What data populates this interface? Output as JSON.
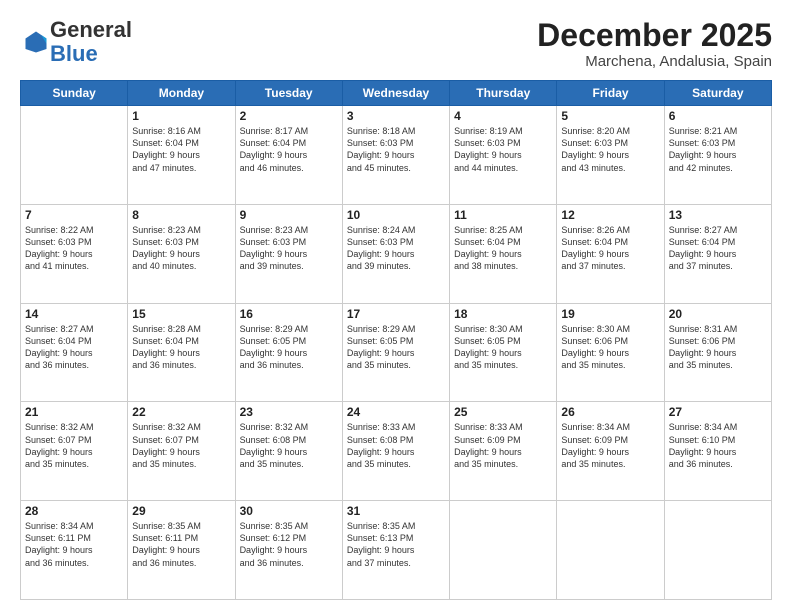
{
  "logo": {
    "general": "General",
    "blue": "Blue"
  },
  "header": {
    "month_year": "December 2025",
    "location": "Marchena, Andalusia, Spain"
  },
  "weekdays": [
    "Sunday",
    "Monday",
    "Tuesday",
    "Wednesday",
    "Thursday",
    "Friday",
    "Saturday"
  ],
  "weeks": [
    [
      {
        "day": "",
        "info": ""
      },
      {
        "day": "1",
        "info": "Sunrise: 8:16 AM\nSunset: 6:04 PM\nDaylight: 9 hours\nand 47 minutes."
      },
      {
        "day": "2",
        "info": "Sunrise: 8:17 AM\nSunset: 6:04 PM\nDaylight: 9 hours\nand 46 minutes."
      },
      {
        "day": "3",
        "info": "Sunrise: 8:18 AM\nSunset: 6:03 PM\nDaylight: 9 hours\nand 45 minutes."
      },
      {
        "day": "4",
        "info": "Sunrise: 8:19 AM\nSunset: 6:03 PM\nDaylight: 9 hours\nand 44 minutes."
      },
      {
        "day": "5",
        "info": "Sunrise: 8:20 AM\nSunset: 6:03 PM\nDaylight: 9 hours\nand 43 minutes."
      },
      {
        "day": "6",
        "info": "Sunrise: 8:21 AM\nSunset: 6:03 PM\nDaylight: 9 hours\nand 42 minutes."
      }
    ],
    [
      {
        "day": "7",
        "info": "Sunrise: 8:22 AM\nSunset: 6:03 PM\nDaylight: 9 hours\nand 41 minutes."
      },
      {
        "day": "8",
        "info": "Sunrise: 8:23 AM\nSunset: 6:03 PM\nDaylight: 9 hours\nand 40 minutes."
      },
      {
        "day": "9",
        "info": "Sunrise: 8:23 AM\nSunset: 6:03 PM\nDaylight: 9 hours\nand 39 minutes."
      },
      {
        "day": "10",
        "info": "Sunrise: 8:24 AM\nSunset: 6:03 PM\nDaylight: 9 hours\nand 39 minutes."
      },
      {
        "day": "11",
        "info": "Sunrise: 8:25 AM\nSunset: 6:04 PM\nDaylight: 9 hours\nand 38 minutes."
      },
      {
        "day": "12",
        "info": "Sunrise: 8:26 AM\nSunset: 6:04 PM\nDaylight: 9 hours\nand 37 minutes."
      },
      {
        "day": "13",
        "info": "Sunrise: 8:27 AM\nSunset: 6:04 PM\nDaylight: 9 hours\nand 37 minutes."
      }
    ],
    [
      {
        "day": "14",
        "info": "Sunrise: 8:27 AM\nSunset: 6:04 PM\nDaylight: 9 hours\nand 36 minutes."
      },
      {
        "day": "15",
        "info": "Sunrise: 8:28 AM\nSunset: 6:04 PM\nDaylight: 9 hours\nand 36 minutes."
      },
      {
        "day": "16",
        "info": "Sunrise: 8:29 AM\nSunset: 6:05 PM\nDaylight: 9 hours\nand 36 minutes."
      },
      {
        "day": "17",
        "info": "Sunrise: 8:29 AM\nSunset: 6:05 PM\nDaylight: 9 hours\nand 35 minutes."
      },
      {
        "day": "18",
        "info": "Sunrise: 8:30 AM\nSunset: 6:05 PM\nDaylight: 9 hours\nand 35 minutes."
      },
      {
        "day": "19",
        "info": "Sunrise: 8:30 AM\nSunset: 6:06 PM\nDaylight: 9 hours\nand 35 minutes."
      },
      {
        "day": "20",
        "info": "Sunrise: 8:31 AM\nSunset: 6:06 PM\nDaylight: 9 hours\nand 35 minutes."
      }
    ],
    [
      {
        "day": "21",
        "info": "Sunrise: 8:32 AM\nSunset: 6:07 PM\nDaylight: 9 hours\nand 35 minutes."
      },
      {
        "day": "22",
        "info": "Sunrise: 8:32 AM\nSunset: 6:07 PM\nDaylight: 9 hours\nand 35 minutes."
      },
      {
        "day": "23",
        "info": "Sunrise: 8:32 AM\nSunset: 6:08 PM\nDaylight: 9 hours\nand 35 minutes."
      },
      {
        "day": "24",
        "info": "Sunrise: 8:33 AM\nSunset: 6:08 PM\nDaylight: 9 hours\nand 35 minutes."
      },
      {
        "day": "25",
        "info": "Sunrise: 8:33 AM\nSunset: 6:09 PM\nDaylight: 9 hours\nand 35 minutes."
      },
      {
        "day": "26",
        "info": "Sunrise: 8:34 AM\nSunset: 6:09 PM\nDaylight: 9 hours\nand 35 minutes."
      },
      {
        "day": "27",
        "info": "Sunrise: 8:34 AM\nSunset: 6:10 PM\nDaylight: 9 hours\nand 36 minutes."
      }
    ],
    [
      {
        "day": "28",
        "info": "Sunrise: 8:34 AM\nSunset: 6:11 PM\nDaylight: 9 hours\nand 36 minutes."
      },
      {
        "day": "29",
        "info": "Sunrise: 8:35 AM\nSunset: 6:11 PM\nDaylight: 9 hours\nand 36 minutes."
      },
      {
        "day": "30",
        "info": "Sunrise: 8:35 AM\nSunset: 6:12 PM\nDaylight: 9 hours\nand 36 minutes."
      },
      {
        "day": "31",
        "info": "Sunrise: 8:35 AM\nSunset: 6:13 PM\nDaylight: 9 hours\nand 37 minutes."
      },
      {
        "day": "",
        "info": ""
      },
      {
        "day": "",
        "info": ""
      },
      {
        "day": "",
        "info": ""
      }
    ]
  ]
}
